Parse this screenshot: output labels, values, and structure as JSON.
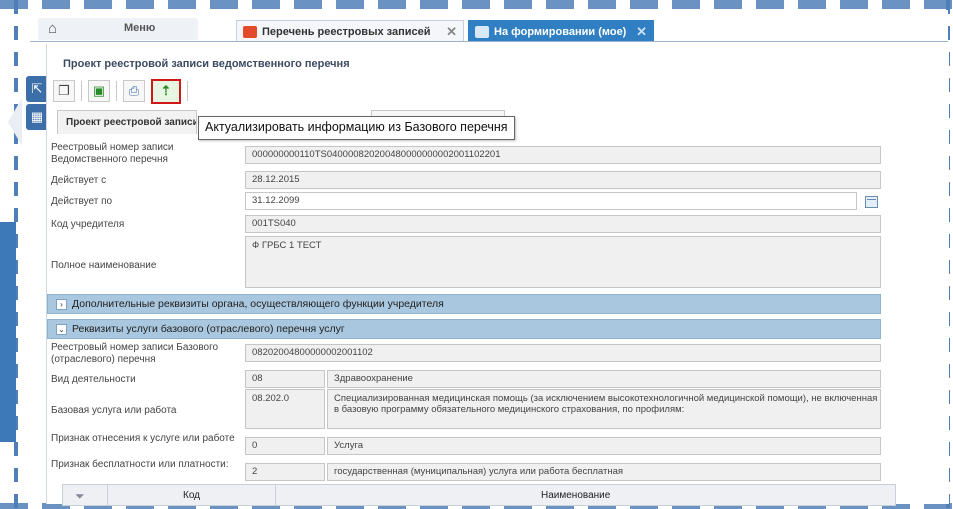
{
  "tabs": {
    "menu_label": "Меню",
    "list_tab": "Перечень реестровых записей",
    "active_tab": "На формировании (мое)"
  },
  "page": {
    "title": "Проект реестровой записи ведомственного перечня"
  },
  "tooltip": "Актуализировать информацию из Базового перечня",
  "subtab": {
    "main": "Проект реестровой записи"
  },
  "form": {
    "reg_number": {
      "label": "Реестровый номер записи Ведомственного перечня",
      "value": "000000000110TS040000820200480000000002001102201"
    },
    "valid_from": {
      "label": "Действует с",
      "value": "28.12.2015"
    },
    "valid_to": {
      "label": "Действует по",
      "value": "31.12.2099"
    },
    "founder_code": {
      "label": "Код учредителя",
      "value": "001TS040"
    },
    "full_name": {
      "label": "Полное наименование",
      "value": "Ф ГРБС 1 ТЕСТ"
    }
  },
  "sections": {
    "additional": "Дополнительные реквизиты органа, осуществляющего функции учредителя",
    "base_service": "Реквизиты услуги базового (отраслевого) перечня услуг"
  },
  "base": {
    "reg_number": {
      "label": "Реестровый номер записи Базового (отраслевого) перечня",
      "value": "08202004800000002001102"
    },
    "activity": {
      "label": "Вид деятельности",
      "code": "08",
      "name": "Здравоохранение"
    },
    "service": {
      "label": "Базовая услуга или работа",
      "code": "08.202.0",
      "name": "Специализированная медицинская помощь (за исключением высокотехнологичной медицинской помощи), не включенная в базовую программу обязательного медицинского страхования, по профилям:"
    },
    "attr_type": {
      "label": "Признак отнесения к услуге или работе",
      "code": "0",
      "name": "Услуга"
    },
    "attr_free": {
      "label": "Признак бесплатности или платности:",
      "code": "2",
      "name": "государственная (муниципальная) услуга или работа бесплатная"
    }
  },
  "grid": {
    "col_code": "Код",
    "col_name": "Наименование"
  },
  "colors": {
    "accent": "#2f7fc2",
    "section_bg": "#a9c7de",
    "highlight_border": "#d01818"
  }
}
